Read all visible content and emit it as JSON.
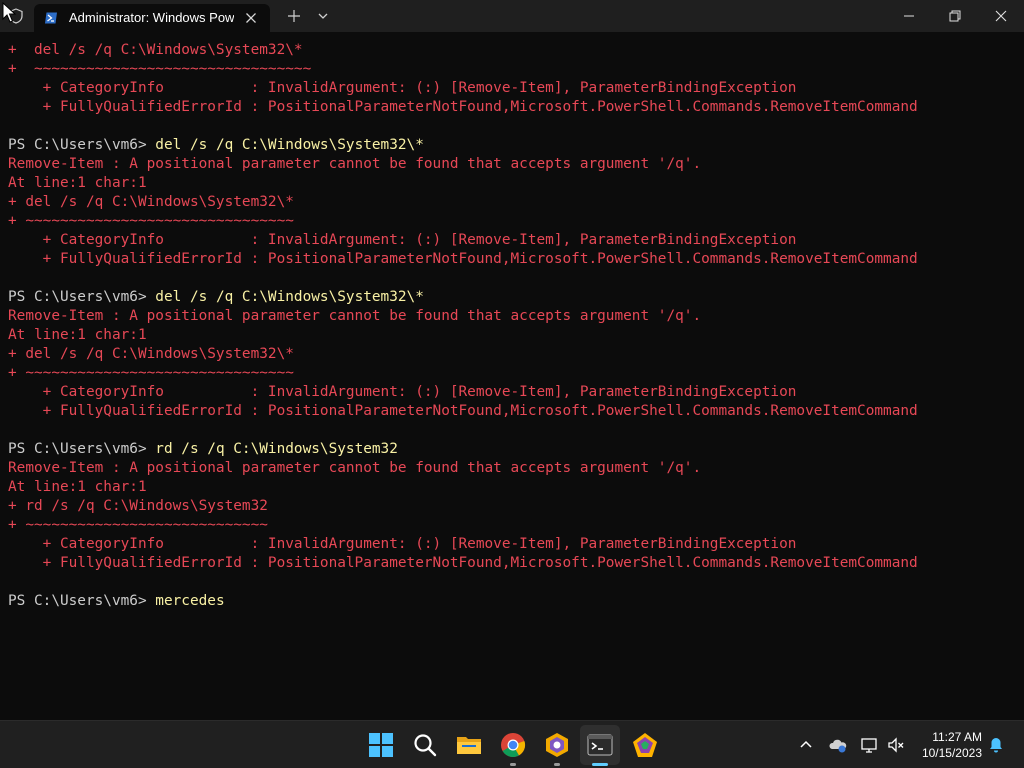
{
  "window": {
    "tab_title": "Administrator: Windows PowerShell"
  },
  "terminal": {
    "lines": [
      {
        "text": "+  del /s /q C:\\Windows\\System32\\*",
        "style": "err"
      },
      {
        "text": "+  ~~~~~~~~~~~~~~~~~~~~~~~~~~~~~~~~",
        "style": "err"
      },
      {
        "text": "    + CategoryInfo          : InvalidArgument: (:) [Remove-Item], ParameterBindingException",
        "style": "err"
      },
      {
        "text": "    + FullyQualifiedErrorId : PositionalParameterNotFound,Microsoft.PowerShell.Commands.RemoveItemCommand",
        "style": "err"
      },
      {
        "text": "",
        "style": "out"
      },
      {
        "prompt": "PS C:\\Users\\vm6> ",
        "cmd": "del /s /q C:\\Windows\\System32\\*"
      },
      {
        "text": "Remove-Item : A positional parameter cannot be found that accepts argument '/q'.",
        "style": "err"
      },
      {
        "text": "At line:1 char:1",
        "style": "err"
      },
      {
        "text": "+ del /s /q C:\\Windows\\System32\\*",
        "style": "err"
      },
      {
        "text": "+ ~~~~~~~~~~~~~~~~~~~~~~~~~~~~~~~",
        "style": "err"
      },
      {
        "text": "    + CategoryInfo          : InvalidArgument: (:) [Remove-Item], ParameterBindingException",
        "style": "err"
      },
      {
        "text": "    + FullyQualifiedErrorId : PositionalParameterNotFound,Microsoft.PowerShell.Commands.RemoveItemCommand",
        "style": "err"
      },
      {
        "text": "",
        "style": "out"
      },
      {
        "prompt": "PS C:\\Users\\vm6> ",
        "cmd": "del /s /q C:\\Windows\\System32\\*"
      },
      {
        "text": "Remove-Item : A positional parameter cannot be found that accepts argument '/q'.",
        "style": "err"
      },
      {
        "text": "At line:1 char:1",
        "style": "err"
      },
      {
        "text": "+ del /s /q C:\\Windows\\System32\\*",
        "style": "err"
      },
      {
        "text": "+ ~~~~~~~~~~~~~~~~~~~~~~~~~~~~~~~",
        "style": "err"
      },
      {
        "text": "    + CategoryInfo          : InvalidArgument: (:) [Remove-Item], ParameterBindingException",
        "style": "err"
      },
      {
        "text": "    + FullyQualifiedErrorId : PositionalParameterNotFound,Microsoft.PowerShell.Commands.RemoveItemCommand",
        "style": "err"
      },
      {
        "text": "",
        "style": "out"
      },
      {
        "prompt": "PS C:\\Users\\vm6> ",
        "cmd": "rd /s /q C:\\Windows\\System32"
      },
      {
        "text": "Remove-Item : A positional parameter cannot be found that accepts argument '/q'.",
        "style": "err"
      },
      {
        "text": "At line:1 char:1",
        "style": "err"
      },
      {
        "text": "+ rd /s /q C:\\Windows\\System32",
        "style": "err"
      },
      {
        "text": "+ ~~~~~~~~~~~~~~~~~~~~~~~~~~~~",
        "style": "err"
      },
      {
        "text": "    + CategoryInfo          : InvalidArgument: (:) [Remove-Item], ParameterBindingException",
        "style": "err"
      },
      {
        "text": "    + FullyQualifiedErrorId : PositionalParameterNotFound,Microsoft.PowerShell.Commands.RemoveItemCommand",
        "style": "err"
      },
      {
        "text": "",
        "style": "out"
      },
      {
        "prompt": "PS C:\\Users\\vm6> ",
        "cmd": "mercedes"
      }
    ]
  },
  "taskbar": {
    "apps": [
      "start-icon",
      "search-icon",
      "file-explorer-icon",
      "chrome-icon",
      "app-hex-icon",
      "terminal-icon",
      "app-gem-icon"
    ],
    "clock": {
      "time": "11:27 AM",
      "date": "10/15/2023"
    }
  },
  "colors": {
    "error": "#e74856",
    "command": "#f9f1a5",
    "text": "#cccccc",
    "background": "#0c0c0c",
    "accent": "#60cdff"
  }
}
